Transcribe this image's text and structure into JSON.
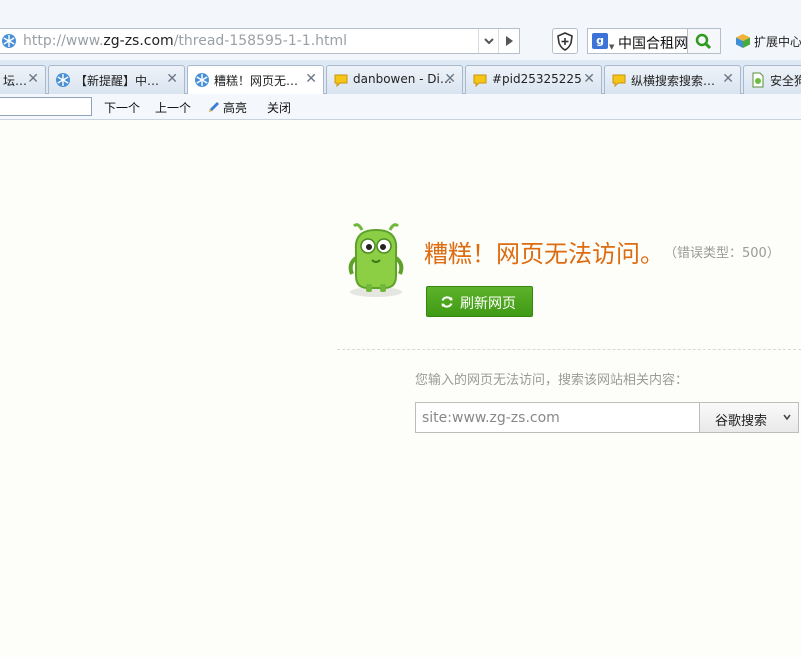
{
  "address_bar": {
    "url_prefix": "http://www.",
    "url_domain": "zg-zs.com",
    "url_path": "/thread-158595-1-1.html"
  },
  "search_box": {
    "engine_icon": "google-g-icon",
    "text": "中国合租网"
  },
  "extensions": {
    "label": "扩展中心"
  },
  "tabs": [
    {
      "label": "坛…",
      "icon": "snowflake-icon",
      "active": false
    },
    {
      "label": "【新提醒】中…",
      "icon": "snowflake-icon",
      "active": false
    },
    {
      "label": "糟糕！网页无…",
      "icon": "snowflake-icon",
      "active": true
    },
    {
      "label": "danbowen - Di…",
      "icon": "speech-bubble-icon",
      "active": false
    },
    {
      "label": "#pid25325225",
      "icon": "speech-bubble-icon",
      "active": false
    },
    {
      "label": "纵横搜索搜索…",
      "icon": "speech-bubble-icon",
      "active": false
    },
    {
      "label": "安全狗",
      "icon": "page-icon",
      "active": false
    }
  ],
  "find_bar": {
    "next": "下一个",
    "prev": "上一个",
    "highlight": "高亮",
    "close": "关闭"
  },
  "error": {
    "title": "糟糕！网页无法访问。",
    "code": "（错误类型：500）",
    "refresh_label": "刷新网页",
    "hint": "您输入的网页无法访问，搜索该网站相关内容：",
    "site_query": "site:www.zg-zs.com",
    "search_button": "谷歌搜索"
  },
  "colors": {
    "title_orange": "#dd6b10",
    "button_green": "#4ea61f",
    "hint_gray": "#9a9a9a"
  }
}
